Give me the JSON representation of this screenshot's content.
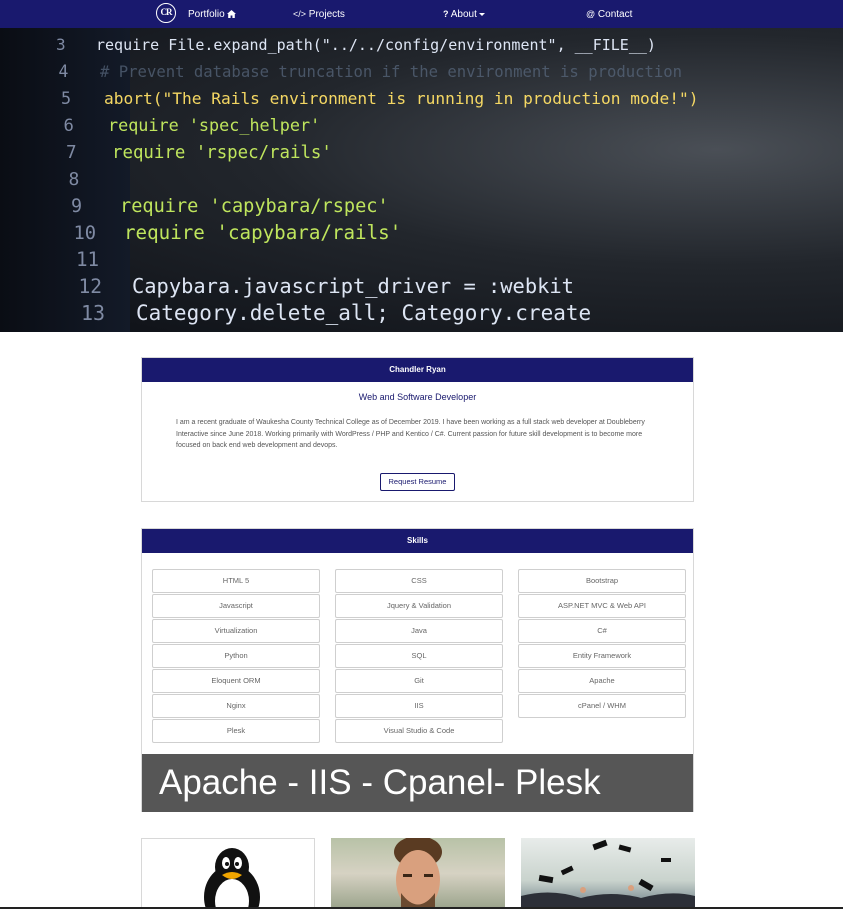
{
  "nav": {
    "logo_text": "CR",
    "items": [
      {
        "label": "Portfolio",
        "icon": "home-icon",
        "icon_glyph": "🏠"
      },
      {
        "label": "Projects",
        "icon": "code-icon",
        "icon_glyph": "</>"
      },
      {
        "label": "About",
        "icon": "question-icon",
        "icon_glyph": "?"
      },
      {
        "label": "Contact",
        "icon": "at-icon",
        "icon_glyph": "@"
      }
    ]
  },
  "hero": {
    "code_lines": [
      {
        "num": "3",
        "text": "require File.expand_path(\"../../config/environment\", __FILE__)"
      },
      {
        "num": "4",
        "text": "# Prevent database truncation if the environment is production"
      },
      {
        "num": "5",
        "text": "abort(\"The Rails environment is running in production mode!\")"
      },
      {
        "num": "6",
        "text": "require 'spec_helper'"
      },
      {
        "num": "7",
        "text": "require 'rspec/rails'"
      },
      {
        "num": "8",
        "text": ""
      },
      {
        "num": "9",
        "text": "require 'capybara/rspec'"
      },
      {
        "num": "10",
        "text": "require 'capybara/rails'"
      },
      {
        "num": "11",
        "text": ""
      },
      {
        "num": "12",
        "text": "Capybara.javascript_driver = :webkit"
      },
      {
        "num": "13",
        "text": "Category.delete_all; Category.create"
      }
    ]
  },
  "about": {
    "header": "Chandler Ryan",
    "subtitle": "Web and Software Developer",
    "bio": "I am a recent graduate of Waukesha County Technical College as of December 2019.  I have been working as a full stack web developer at Doubleberry Interactive since June 2018. Working primarily with WordPress / PHP and Kentico / C#. Current passion for future skill development is to become more focused on back end web development and devops.",
    "resume_button": "Request Resume"
  },
  "skills": {
    "header": "Skills",
    "columns": [
      [
        "HTML 5",
        "Javascript",
        "Virtualization",
        "Python",
        "Eloquent ORM",
        "Nginx",
        "Plesk"
      ],
      [
        "CSS",
        "Jquery & Validation",
        "Java",
        "SQL",
        "Git",
        "IIS",
        "Visual Studio & Code"
      ],
      [
        "Bootstrap",
        "ASP.NET MVC & Web API",
        "C#",
        "Entity Framework",
        "Apache",
        "cPanel / WHM"
      ]
    ],
    "banner": "Apache - IIS - Cpanel- Plesk"
  },
  "thumbnails": [
    {
      "name": "tux-penguin-thumbnail"
    },
    {
      "name": "man-portrait-thumbnail"
    },
    {
      "name": "graduation-caps-thumbnail"
    }
  ],
  "colors": {
    "brand": "#19196e",
    "banner": "#565656"
  }
}
